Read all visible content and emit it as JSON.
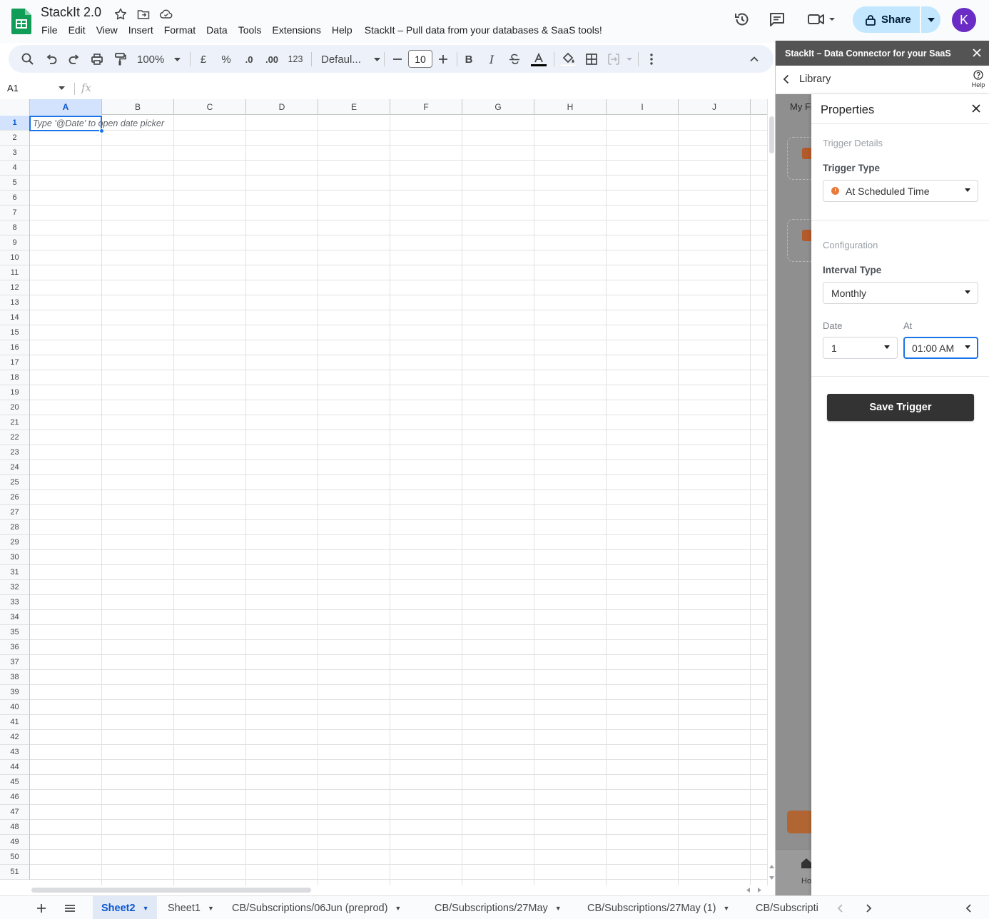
{
  "app": {
    "doc_title": "StackIt 2.0",
    "menus": [
      "File",
      "Edit",
      "View",
      "Insert",
      "Format",
      "Data",
      "Tools",
      "Extensions",
      "Help"
    ],
    "addon_menu": "StackIt – Pull data from your databases & SaaS tools!",
    "share_label": "Share",
    "avatar_initial": "K"
  },
  "toolbar": {
    "zoom": "100%",
    "currency": "£",
    "percent": "%",
    "dec_decrease": ".0",
    "dec_increase": ".00",
    "number_format": "123",
    "font": "Defaul...",
    "font_size": "10",
    "bold": "B",
    "italic": "I"
  },
  "formula_bar": {
    "cell_ref": "A1",
    "fx": "fx"
  },
  "grid": {
    "columns": [
      "A",
      "B",
      "C",
      "D",
      "E",
      "F",
      "G",
      "H",
      "I",
      "J"
    ],
    "rows": [
      "1",
      "2",
      "3",
      "4",
      "5",
      "6",
      "7",
      "8",
      "9",
      "10",
      "11",
      "12",
      "13",
      "14",
      "15",
      "16",
      "17",
      "18",
      "19",
      "20",
      "21",
      "22",
      "23",
      "24",
      "25",
      "26",
      "27",
      "28",
      "29",
      "30",
      "31",
      "32",
      "33",
      "34",
      "35",
      "36",
      "37",
      "38",
      "39",
      "40",
      "41",
      "42",
      "43",
      "44",
      "45",
      "46",
      "47",
      "48",
      "49",
      "50",
      "51"
    ],
    "selected_cell": "A1",
    "a1_hint": "Type '@Date' to open date picker"
  },
  "sheet_tabs": [
    "Sheet2",
    "Sheet1",
    "CB/Subscriptions/06Jun (preprod)",
    "CB/Subscriptions/27May",
    "CB/Subscriptions/27May (1)",
    "CB/Subscripti"
  ],
  "active_tab": "Sheet2",
  "side_panel": {
    "header": "StackIt – Data Connector for your SaaS",
    "library_label": "Library",
    "help_label": "Help",
    "peek_tab": "My Fi",
    "peek_nav_label": "Ho",
    "properties": {
      "title": "Properties",
      "trigger_details_label": "Trigger Details",
      "trigger_type_label": "Trigger Type",
      "trigger_type_value": "At Scheduled Time",
      "configuration_label": "Configuration",
      "interval_type_label": "Interval Type",
      "interval_type_value": "Monthly",
      "date_label": "Date",
      "date_value": "1",
      "at_label": "At",
      "at_value": "01:00 AM",
      "save_label": "Save Trigger"
    }
  },
  "colors": {
    "accent": "#1a73e8",
    "share_bg": "#c2e7ff",
    "panel_header": "#545454",
    "save_button": "#333333",
    "trigger_icon": "#e87a3a"
  }
}
